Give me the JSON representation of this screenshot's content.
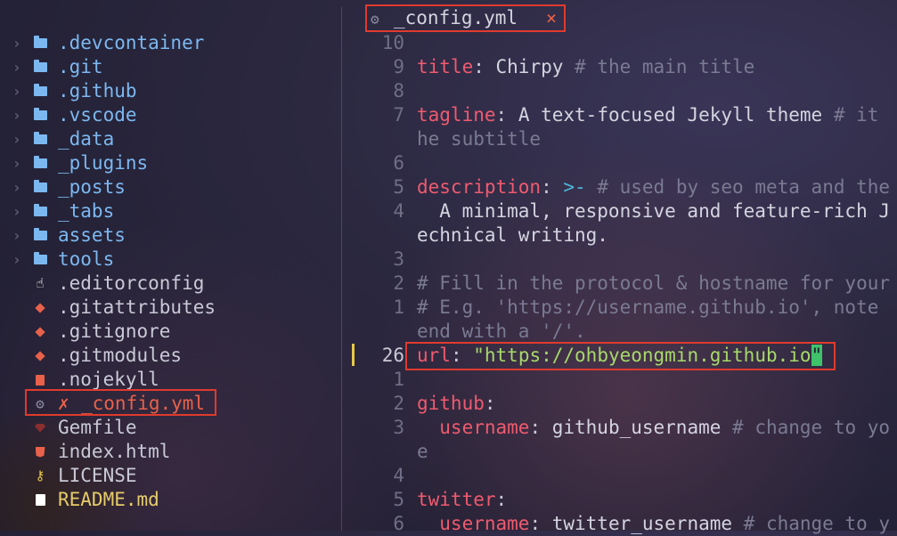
{
  "sidebar": {
    "items": [
      {
        "label": ".devcontainer",
        "type": "folder",
        "icon": "folder-icon"
      },
      {
        "label": ".git",
        "type": "folder",
        "icon": "folder-icon"
      },
      {
        "label": ".github",
        "type": "folder",
        "icon": "folder-icon"
      },
      {
        "label": ".vscode",
        "type": "folder",
        "icon": "folder-icon"
      },
      {
        "label": "_data",
        "type": "folder",
        "icon": "folder-icon"
      },
      {
        "label": "_plugins",
        "type": "folder",
        "icon": "folder-icon"
      },
      {
        "label": "_posts",
        "type": "folder",
        "icon": "folder-icon"
      },
      {
        "label": "_tabs",
        "type": "folder",
        "icon": "folder-icon"
      },
      {
        "label": "assets",
        "type": "folder",
        "icon": "folder-icon"
      },
      {
        "label": "tools",
        "type": "folder",
        "icon": "folder-icon"
      },
      {
        "label": ".editorconfig",
        "type": "file",
        "icon": "editorconfig-icon"
      },
      {
        "label": ".gitattributes",
        "type": "file",
        "icon": "git-icon"
      },
      {
        "label": ".gitignore",
        "type": "file",
        "icon": "git-icon"
      },
      {
        "label": ".gitmodules",
        "type": "file",
        "icon": "git-icon"
      },
      {
        "label": ".nojekyll",
        "type": "file",
        "icon": "document-icon"
      },
      {
        "label": "_config.yml",
        "type": "file",
        "icon": "gear-icon",
        "modified_mark": "✗"
      },
      {
        "label": "Gemfile",
        "type": "file",
        "icon": "ruby-gem-icon"
      },
      {
        "label": "index.html",
        "type": "file",
        "icon": "html5-icon"
      },
      {
        "label": "LICENSE",
        "type": "file",
        "icon": "key-icon"
      },
      {
        "label": "README.md",
        "type": "file",
        "icon": "markdown-icon"
      }
    ],
    "chevron": "›"
  },
  "tab": {
    "label": "_config.yml",
    "icon": "gear-icon",
    "close": "×"
  },
  "editor": {
    "line_numbers": [
      "10",
      "9",
      "8",
      "7",
      "",
      "6",
      "5",
      "4",
      "",
      "3",
      "2",
      "1",
      "",
      "26",
      "1",
      "2",
      "3",
      "",
      "4",
      "5",
      "6"
    ],
    "lines": {
      "l1_key": "title",
      "l1_val": " Chirpy ",
      "l1_comment": "# the main title",
      "l3_key": "tagline",
      "l3_val": " A text-focused Jekyll theme ",
      "l3_comment": "# it",
      "l3_wrap": "he subtitle",
      "l5_key": "description",
      "l5_op": ">-",
      "l5_comment": " # used by seo meta and the",
      "l6_val": "  A minimal, responsive and feature-rich J",
      "l6_wrap": "echnical writing.",
      "l8_comment": "# Fill in the protocol & hostname for your",
      "l9_comment": "# E.g. 'https://username.github.io', note",
      "l9_wrap": "end with a '/'.",
      "url_key": "url",
      "url_val": "\"https://ohbyeongmin.github.io",
      "url_cursor": "\"",
      "github_key": "github",
      "gh_user_key": "  username",
      "gh_user_val": " github_username ",
      "gh_user_comment": "# change to yo",
      "gh_user_wrap": "e",
      "twitter_key": "twitter",
      "tw_user_key": "  username",
      "tw_user_val": " twitter_username ",
      "tw_user_comment": "# change to y",
      "colon": ":"
    }
  },
  "colors": {
    "accent_highlight": "#e03a2e",
    "folder": "#7cb8f0",
    "yaml_key": "#ef5a6f",
    "string": "#a6d96a",
    "cursor": "#3ec26a"
  }
}
